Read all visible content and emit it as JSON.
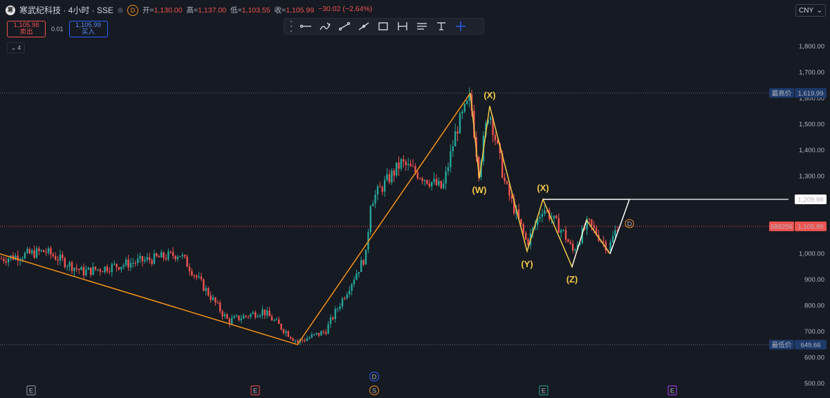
{
  "header": {
    "logo_text": "寒",
    "title": "寒武纪科技 · 4小时 · SSE",
    "badge": "D",
    "ohlc": {
      "open_label": "开=",
      "open": "1,130.00",
      "high_label": "高=",
      "high": "1,137.00",
      "low_label": "低=",
      "low": "1,103.55",
      "close_label": "收=",
      "close": "1,105.99",
      "change": "−30.02 (−2.64%)"
    }
  },
  "trade": {
    "sell_price": "1,105.98",
    "sell_label": "卖出",
    "spread": "0.01",
    "buy_price": "1,105.99",
    "buy_label": "买入"
  },
  "indicator_toggle": "4",
  "toolbar": {
    "tools": [
      "grip-handle-icon",
      "horizontal-ray-icon",
      "brush-icon",
      "trend-line-icon",
      "line-icon",
      "rectangle-icon",
      "price-range-icon",
      "text-lines-icon",
      "text-icon",
      "crosshair-icon"
    ]
  },
  "currency": "CNY",
  "chart_data": {
    "type": "candlestick",
    "yaxis": {
      "min": 500,
      "max": 1850,
      "ticks": [
        "1,800.00",
        "1,700.00",
        "1,600.00",
        "1,500.00",
        "1,400.00",
        "1,300.00",
        "1,200.00",
        "1,100.00",
        "1,000.00",
        "900.00",
        "800.00",
        "700.00",
        "600.00",
        "500.00"
      ]
    },
    "markers": {
      "high": {
        "label": "最高价",
        "value": "1,619.99"
      },
      "low": {
        "label": "最低价",
        "value": "649.66"
      },
      "level": {
        "value": "1,209.98"
      },
      "current": {
        "symbol": "688256",
        "value": "1,105.99"
      }
    },
    "wave_labels": [
      "(X)",
      "(W)",
      "(X)",
      "(Y)",
      "(Z)"
    ],
    "end_badge": "D",
    "event_markers": [
      "E",
      "E",
      "D",
      "S",
      "E",
      "E"
    ],
    "colors": {
      "up": "#26a69a",
      "down": "#ef5350",
      "orange": "#f7931a",
      "yellow": "#f2c94c",
      "white": "#ffffff"
    }
  }
}
